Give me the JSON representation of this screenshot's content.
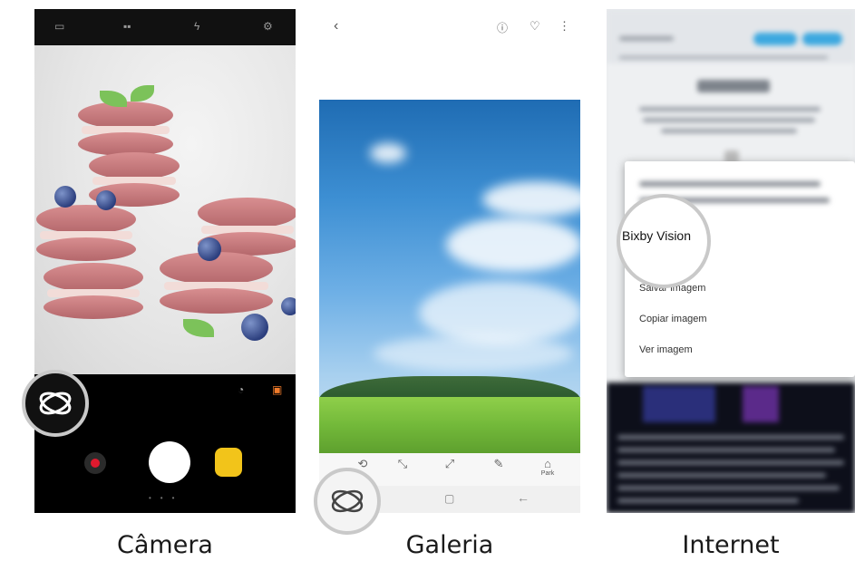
{
  "captions": {
    "camera": "Câmera",
    "gallery": "Galeria",
    "internet": "Internet"
  },
  "internet_menu": {
    "bixby": "Bixby Vision",
    "items": [
      "Salvar imagem",
      "Copiar imagem",
      "Ver imagem"
    ]
  },
  "gallery_tools": [
    "Park"
  ],
  "colors": {
    "record_red": "#e0192e",
    "gallery_yellow": "#f2c41a",
    "sky_blue": "#3d8fd3",
    "grass_green": "#73b93a",
    "link_blue": "#3ca8e0"
  },
  "icons": {
    "bixby_vision": "bixby-eye-icon",
    "back": "back-arrow-icon",
    "info": "info-icon",
    "favorite": "heart-icon",
    "more": "more-vertical-icon",
    "settings": "gear-icon",
    "flash": "flash-icon",
    "record": "record-icon"
  }
}
